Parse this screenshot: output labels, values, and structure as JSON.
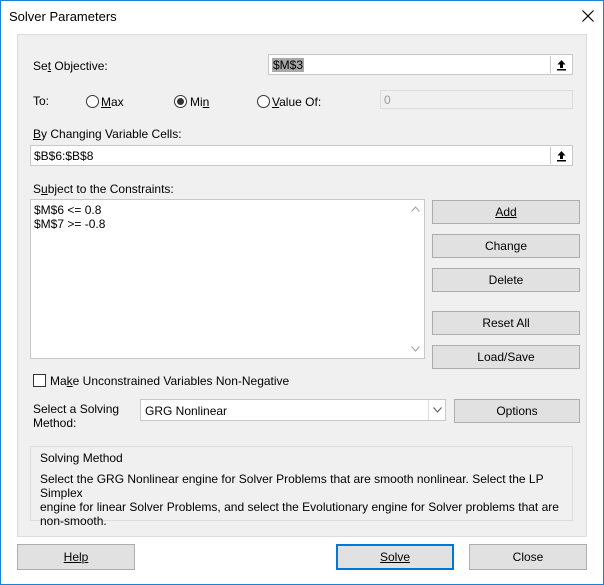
{
  "window": {
    "title": "Solver Parameters"
  },
  "objective": {
    "label": "Set Objective:",
    "mnemonic": "t",
    "value": "$M$3"
  },
  "to": {
    "label": "To:",
    "options": [
      {
        "label": "Max",
        "selected": false
      },
      {
        "label": "Min",
        "selected": true
      },
      {
        "label": "Value Of:",
        "selected": false
      }
    ],
    "value_of_field": "0"
  },
  "changing": {
    "label": "By Changing Variable Cells:",
    "value": "$B$6:$B$8"
  },
  "constraints": {
    "label": "Subject to the Constraints:",
    "items": [
      "$M$6 <= 0.8",
      "$M$7 >= -0.8"
    ]
  },
  "constraint_buttons": {
    "add": "Add",
    "change": "Change",
    "delete": "Delete",
    "reset_all": "Reset All",
    "load_save": "Load/Save"
  },
  "nonneg": {
    "label": "Make Unconstrained Variables Non-Negative",
    "checked": false
  },
  "solving_method": {
    "label_line1": "Select a Solving",
    "label_line2": "Method:",
    "selected": "GRG Nonlinear",
    "options_button": "Options"
  },
  "method_info": {
    "heading": "Solving Method",
    "lines": [
      "Select the GRG Nonlinear engine for Solver Problems that are smooth nonlinear. Select the LP Simplex",
      "engine for linear Solver Problems, and select the Evolutionary engine for Solver problems that are",
      "non-smooth."
    ]
  },
  "footer": {
    "help": "Help",
    "solve": "Solve",
    "close": "Close"
  },
  "colors": {
    "accent": "#0078d7",
    "panel": "#f0f0f0",
    "button": "#e1e1e1"
  },
  "icons": {
    "close": "close-icon",
    "ref": "collapse-dialog-icon",
    "dropdown": "chevron-down-icon"
  }
}
